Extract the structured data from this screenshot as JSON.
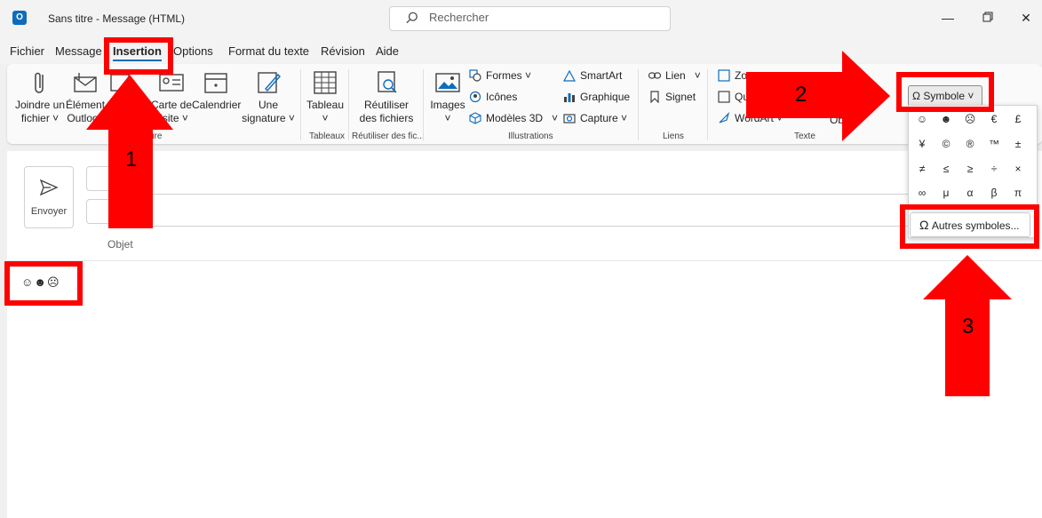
{
  "window": {
    "title": "Sans titre  -  Message (HTML)",
    "app_icon": "outlook-icon",
    "search_placeholder": "Rechercher",
    "controls": [
      "minimize-icon",
      "restore-icon",
      "close-icon"
    ]
  },
  "menu": {
    "tabs": [
      {
        "label": "Fichier"
      },
      {
        "label": "Message"
      },
      {
        "label": "Insertion",
        "active": true
      },
      {
        "label": "Options"
      },
      {
        "label": "Format du texte"
      },
      {
        "label": "Révision"
      },
      {
        "label": "Aide"
      }
    ]
  },
  "ribbon": {
    "include": {
      "attach": {
        "line1": "Joindre un",
        "line2": "fichier"
      },
      "outlook_item": {
        "line1": "Élément",
        "line2": "Outlook"
      },
      "signature_partial": {
        "line1": "S"
      },
      "business_card": {
        "line1": "Carte de",
        "line2": "visite"
      },
      "calendar": {
        "line1": "Calendrier"
      },
      "signature": {
        "line1": "Une",
        "line2": "signature"
      },
      "group_label": "ure"
    },
    "tables": {
      "label": "Tableau",
      "group_label": "Tableaux"
    },
    "reuse": {
      "line1": "Réutiliser",
      "line2": "des fichiers",
      "group_label": "Réutiliser des fic..."
    },
    "illustrations": {
      "images": "Images",
      "shapes": "Formes",
      "icons": "Icônes",
      "models3d": "Modèles 3D",
      "smartart": "SmartArt",
      "chart": "Graphique",
      "capture": "Capture",
      "group_label": "Illustrations"
    },
    "links": {
      "link": "Lien",
      "bookmark": "Signet",
      "group_label": "Liens"
    },
    "text": {
      "zoom_partial": "Zo",
      "quick_partial": "Qu",
      "wordart": "WordArt",
      "object_partial": "Ob",
      "group_label": "Texte"
    },
    "symbols": {
      "button": "Symbole"
    }
  },
  "symbol_panel": {
    "rows": [
      [
        "☺",
        "☻",
        "☹",
        "€",
        "£"
      ],
      [
        "¥",
        "©",
        "®",
        "™",
        "±"
      ],
      [
        "≠",
        "≤",
        "≥",
        "÷",
        "×"
      ],
      [
        "∞",
        "μ",
        "α",
        "β",
        "π"
      ]
    ],
    "more": "Autres symboles..."
  },
  "compose": {
    "send": "Envoyer",
    "subject_label": "Objet",
    "body_emojis": "☺☻☹"
  },
  "annotations": {
    "steps": [
      "1",
      "2",
      "3"
    ],
    "color": "#ff0000"
  }
}
